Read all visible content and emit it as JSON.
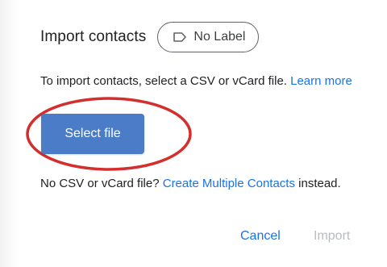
{
  "dialog": {
    "title": "Import contacts",
    "label_chip": {
      "icon": "label-icon",
      "text": "No Label"
    },
    "intro_text": "To import contacts, select a CSV or vCard file.",
    "learn_more_link": "Learn more",
    "select_file_button": "Select file",
    "alt_prefix": "No CSV or vCard file?",
    "create_multiple_link": "Create Multiple Contacts",
    "alt_suffix": "instead.",
    "cancel_button": "Cancel",
    "import_button": "Import"
  },
  "colors": {
    "primary_button": "#4a7cc7",
    "link": "#1a73e8",
    "disabled": "#b8bcc1",
    "annotation_oval": "#d32f2f"
  }
}
